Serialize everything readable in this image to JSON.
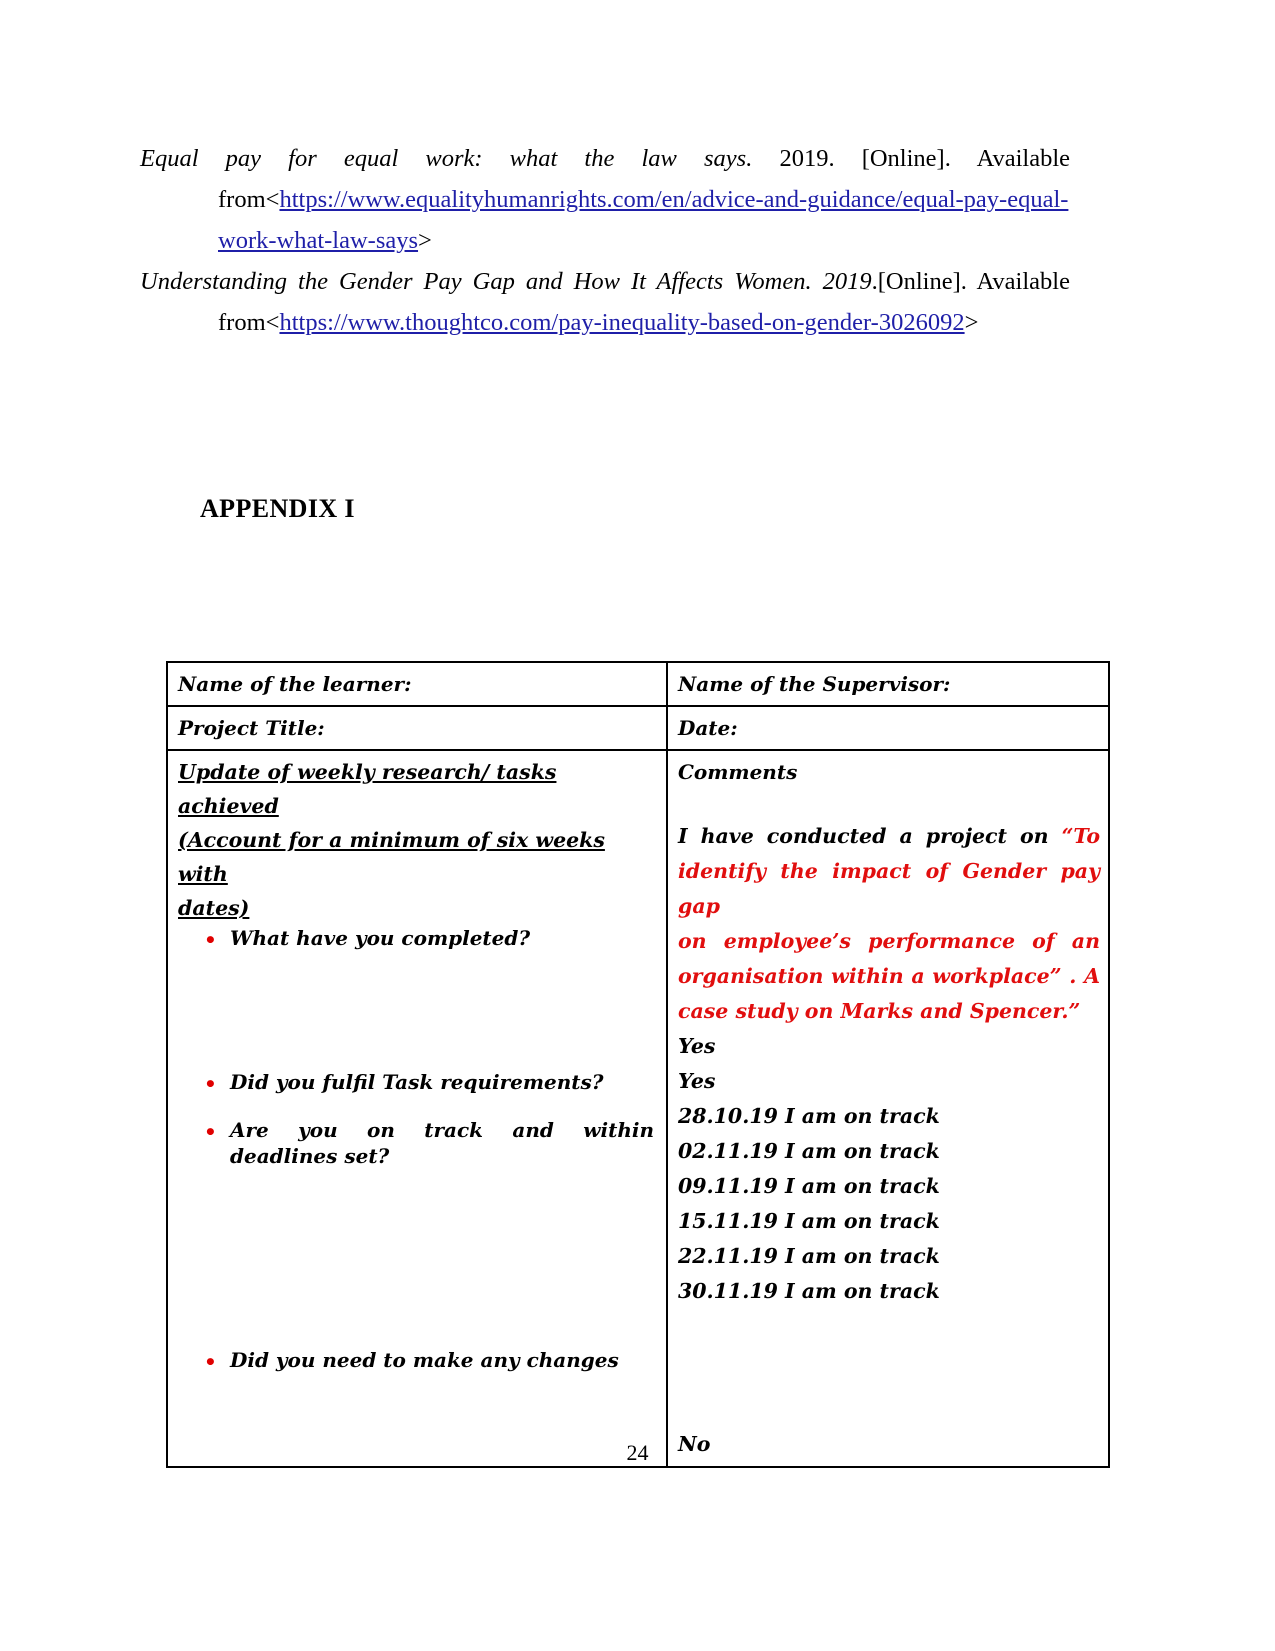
{
  "references": [
    {
      "title": "Equal pay for equal work: what the law says.",
      "year_and_meta": "2019. [Online]. Available",
      "from_label": "from<",
      "url": "https://www.equalityhumanrights.com/en/advice-and-guidance/equal-pay-equal-work-what-law-says",
      "url_line1": "https://www.equalityhumanrights.com/en/advice-and-guidance/equal-pay-equal-",
      "url_line2": "work-what-law-says",
      "close_bracket": ">"
    },
    {
      "title": "Understanding the Gender Pay Gap and How It Affects Women. 2019",
      "year_and_meta": ".[Online]. Available",
      "from_label": "from<",
      "url": "https://www.thoughtco.com/pay-inequality-based-on-gender-3026092",
      "url_line1": "https://www.thoughtco.com/pay-inequality-based-on-gender-3026092",
      "url_line2": "",
      "close_bracket": ">"
    }
  ],
  "appendix": {
    "heading": "APPENDIX I"
  },
  "form": {
    "row1": {
      "left": "Name of the learner:",
      "right": "Name of the Supervisor:"
    },
    "row2": {
      "left": "Project Title:",
      "right": "Date:"
    },
    "row3": {
      "left_heading_line1": "Update of weekly research/ tasks achieved",
      "left_heading_line2": "(Account for a minimum of six weeks with",
      "left_heading_line3": "dates)",
      "questions": [
        {
          "text": "What have you completed?",
          "bullet": "•"
        },
        {
          "text": "Did you fulfil Task requirements?",
          "bullet": "•"
        },
        {
          "text_line1": "Are you on track and within",
          "text_line2": "deadlines set?",
          "bullet": "•"
        },
        {
          "text": "Did you need to make any changes",
          "bullet": "•"
        }
      ],
      "right_heading": "Comments",
      "project_statement": {
        "lead": "I have conducted a project on ",
        "quoted_line1": "“To",
        "quoted_line2": "identify the impact of Gender pay gap",
        "quoted_line3": "on employee’s performance of an",
        "quoted_line4": "organisation within a workplace” . A",
        "quoted_line5": "case study on Marks and Spencer.”"
      },
      "answers": [
        "Yes",
        "Yes",
        "28.10.19 I am on track",
        "02.11.19 I am on track",
        "09.11.19 I am on track",
        "15.11.19 I am on track",
        "22.11.19 I am on track",
        "30.11.19 I am on track"
      ],
      "final_answer": "No"
    }
  },
  "footer": {
    "page_number": "24"
  },
  "colors": {
    "link": "#1f1fa8",
    "red_text": "#e10e0e",
    "bullet_red": "#e00000",
    "text": "#000000"
  }
}
